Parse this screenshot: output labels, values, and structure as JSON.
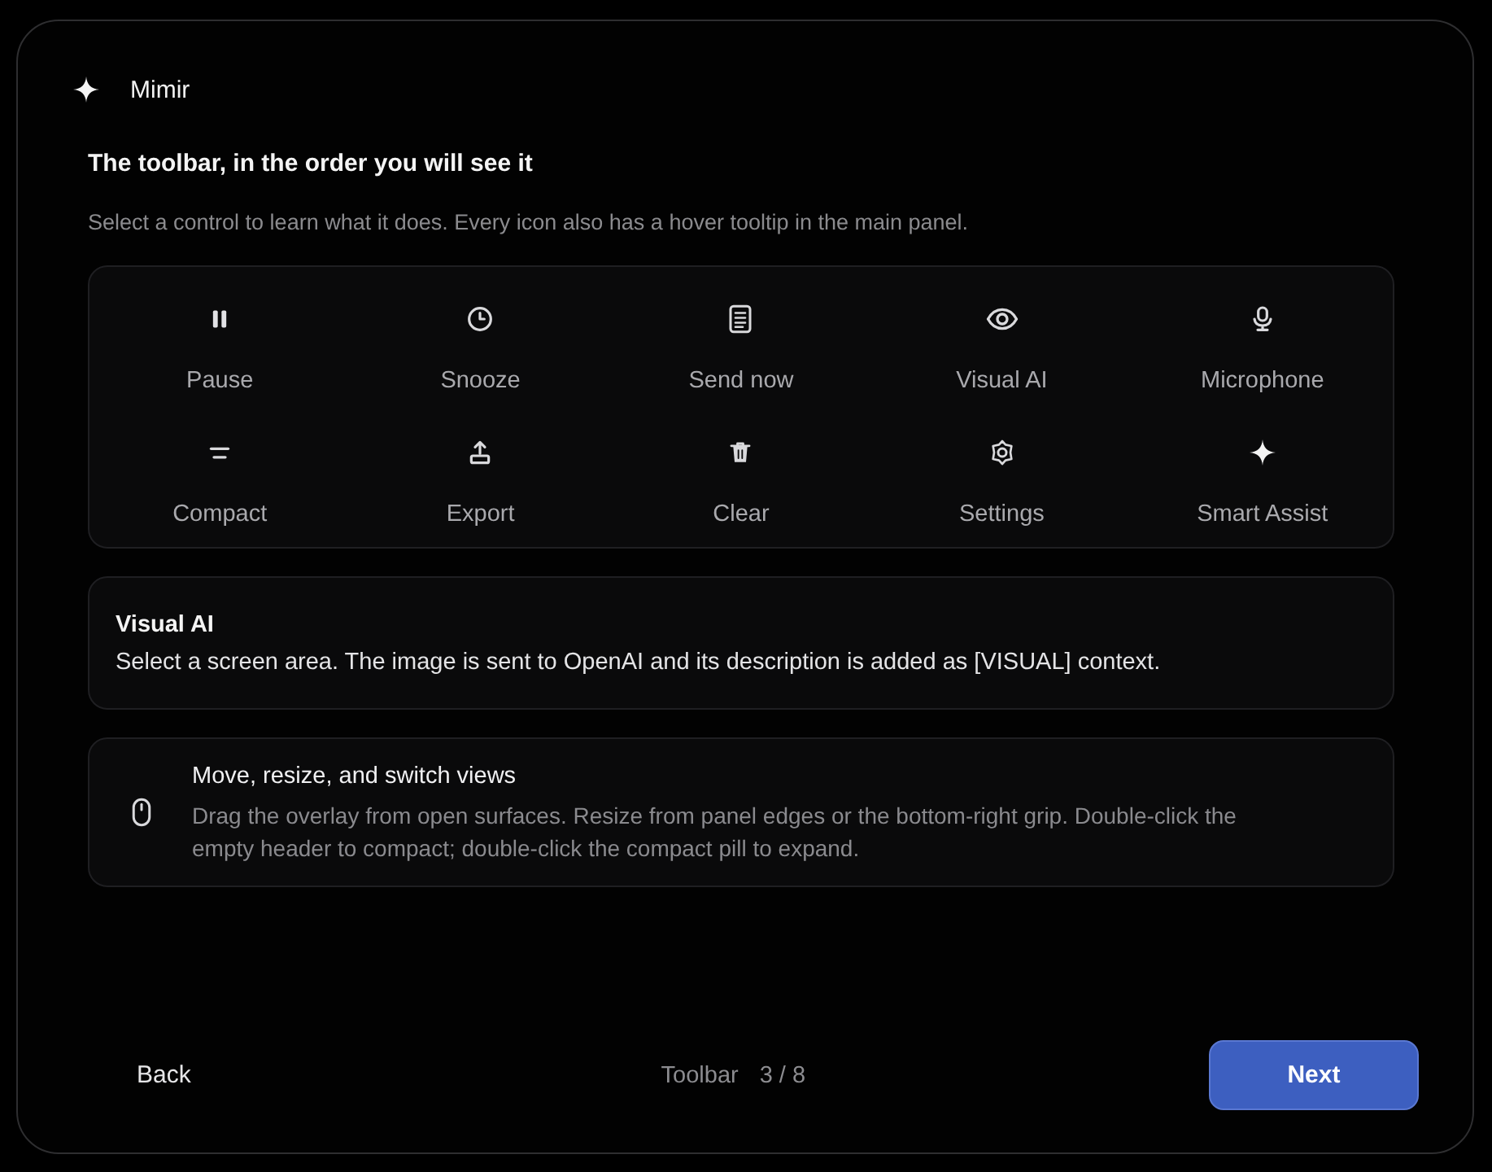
{
  "window": {
    "title": "Mimir"
  },
  "heading": "The toolbar, in the order you will see it",
  "description": "Select a control to learn what it does. Every icon also has a hover tooltip in the main panel.",
  "toolbar": {
    "items": [
      {
        "label": "Pause"
      },
      {
        "label": "Snooze"
      },
      {
        "label": "Send now"
      },
      {
        "label": "Visual AI"
      },
      {
        "label": "Microphone"
      },
      {
        "label": "Compact"
      },
      {
        "label": "Export"
      },
      {
        "label": "Clear"
      },
      {
        "label": "Settings"
      },
      {
        "label": "Smart Assist"
      }
    ]
  },
  "detail": {
    "title": "Visual AI",
    "text": "Select a screen area. The image is sent to OpenAI and its description is added as [VISUAL] context."
  },
  "tip": {
    "title": "Move, resize, and switch views",
    "text": "Drag the overlay from open surfaces. Resize from panel edges or the bottom-right grip. Double-click the empty header to compact; double-click the compact pill to expand."
  },
  "footer": {
    "back": "Back",
    "step_label": "Toolbar",
    "step_count": "3 / 8",
    "next": "Next"
  }
}
